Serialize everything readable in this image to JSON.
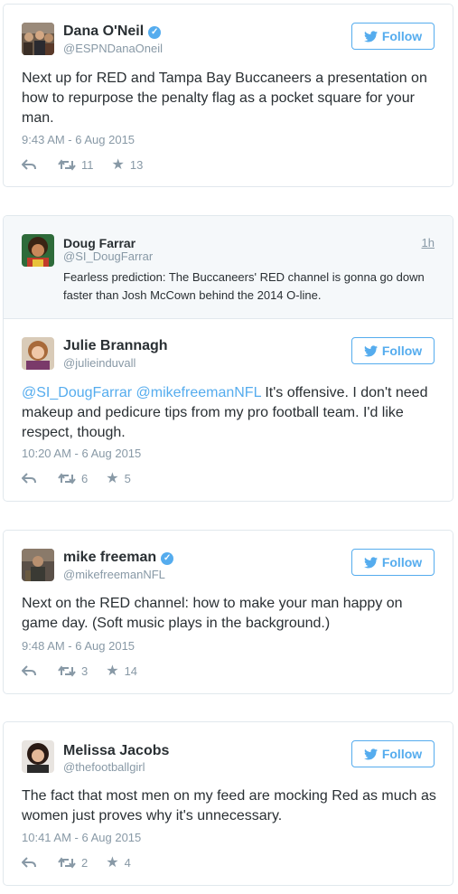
{
  "follow_label": "Follow",
  "colors": {
    "accent": "#55acee",
    "meta": "#8899a6",
    "text": "#292f33",
    "border": "#e1e8ed"
  },
  "tweets": [
    {
      "name": "Dana O'Neil",
      "verified": true,
      "handle": "@ESPNDanaOneil",
      "text": "Next up for RED and Tampa Bay Buccaneers a presentation on how to repurpose the penalty flag as a pocket square for your man.",
      "time": "9:43 AM - 6 Aug 2015",
      "retweets": "11",
      "favorites": "13"
    },
    {
      "quoted": {
        "name": "Doug Farrar",
        "handle": "@SI_DougFarrar",
        "time": "1h",
        "text": "Fearless prediction: The Buccaneers' RED channel is gonna go down faster than Josh McCown behind the 2014 O-line."
      },
      "name": "Julie Brannagh",
      "verified": false,
      "handle": "@julieinduvall",
      "mention_1": "@SI_DougFarrar",
      "mention_2": "@mikefreemanNFL",
      "text_rest": " It's offensive. I don't need makeup and pedicure tips from my pro football team. I'd like respect, though.",
      "time": "10:20 AM - 6 Aug 2015",
      "retweets": "6",
      "favorites": "5"
    },
    {
      "name": "mike freeman",
      "verified": true,
      "handle": "@mikefreemanNFL",
      "text": "Next on the RED channel: how to make your man happy on game day. (Soft music plays in the background.)",
      "time": "9:48 AM - 6 Aug 2015",
      "retweets": "3",
      "favorites": "14"
    },
    {
      "name": "Melissa Jacobs",
      "verified": false,
      "handle": "@thefootballgirl",
      "text": "The fact that most men on my feed are mocking Red as much as women just proves why it's unnecessary.",
      "time": "10:41 AM - 6 Aug 2015",
      "retweets": "2",
      "favorites": "4"
    }
  ]
}
